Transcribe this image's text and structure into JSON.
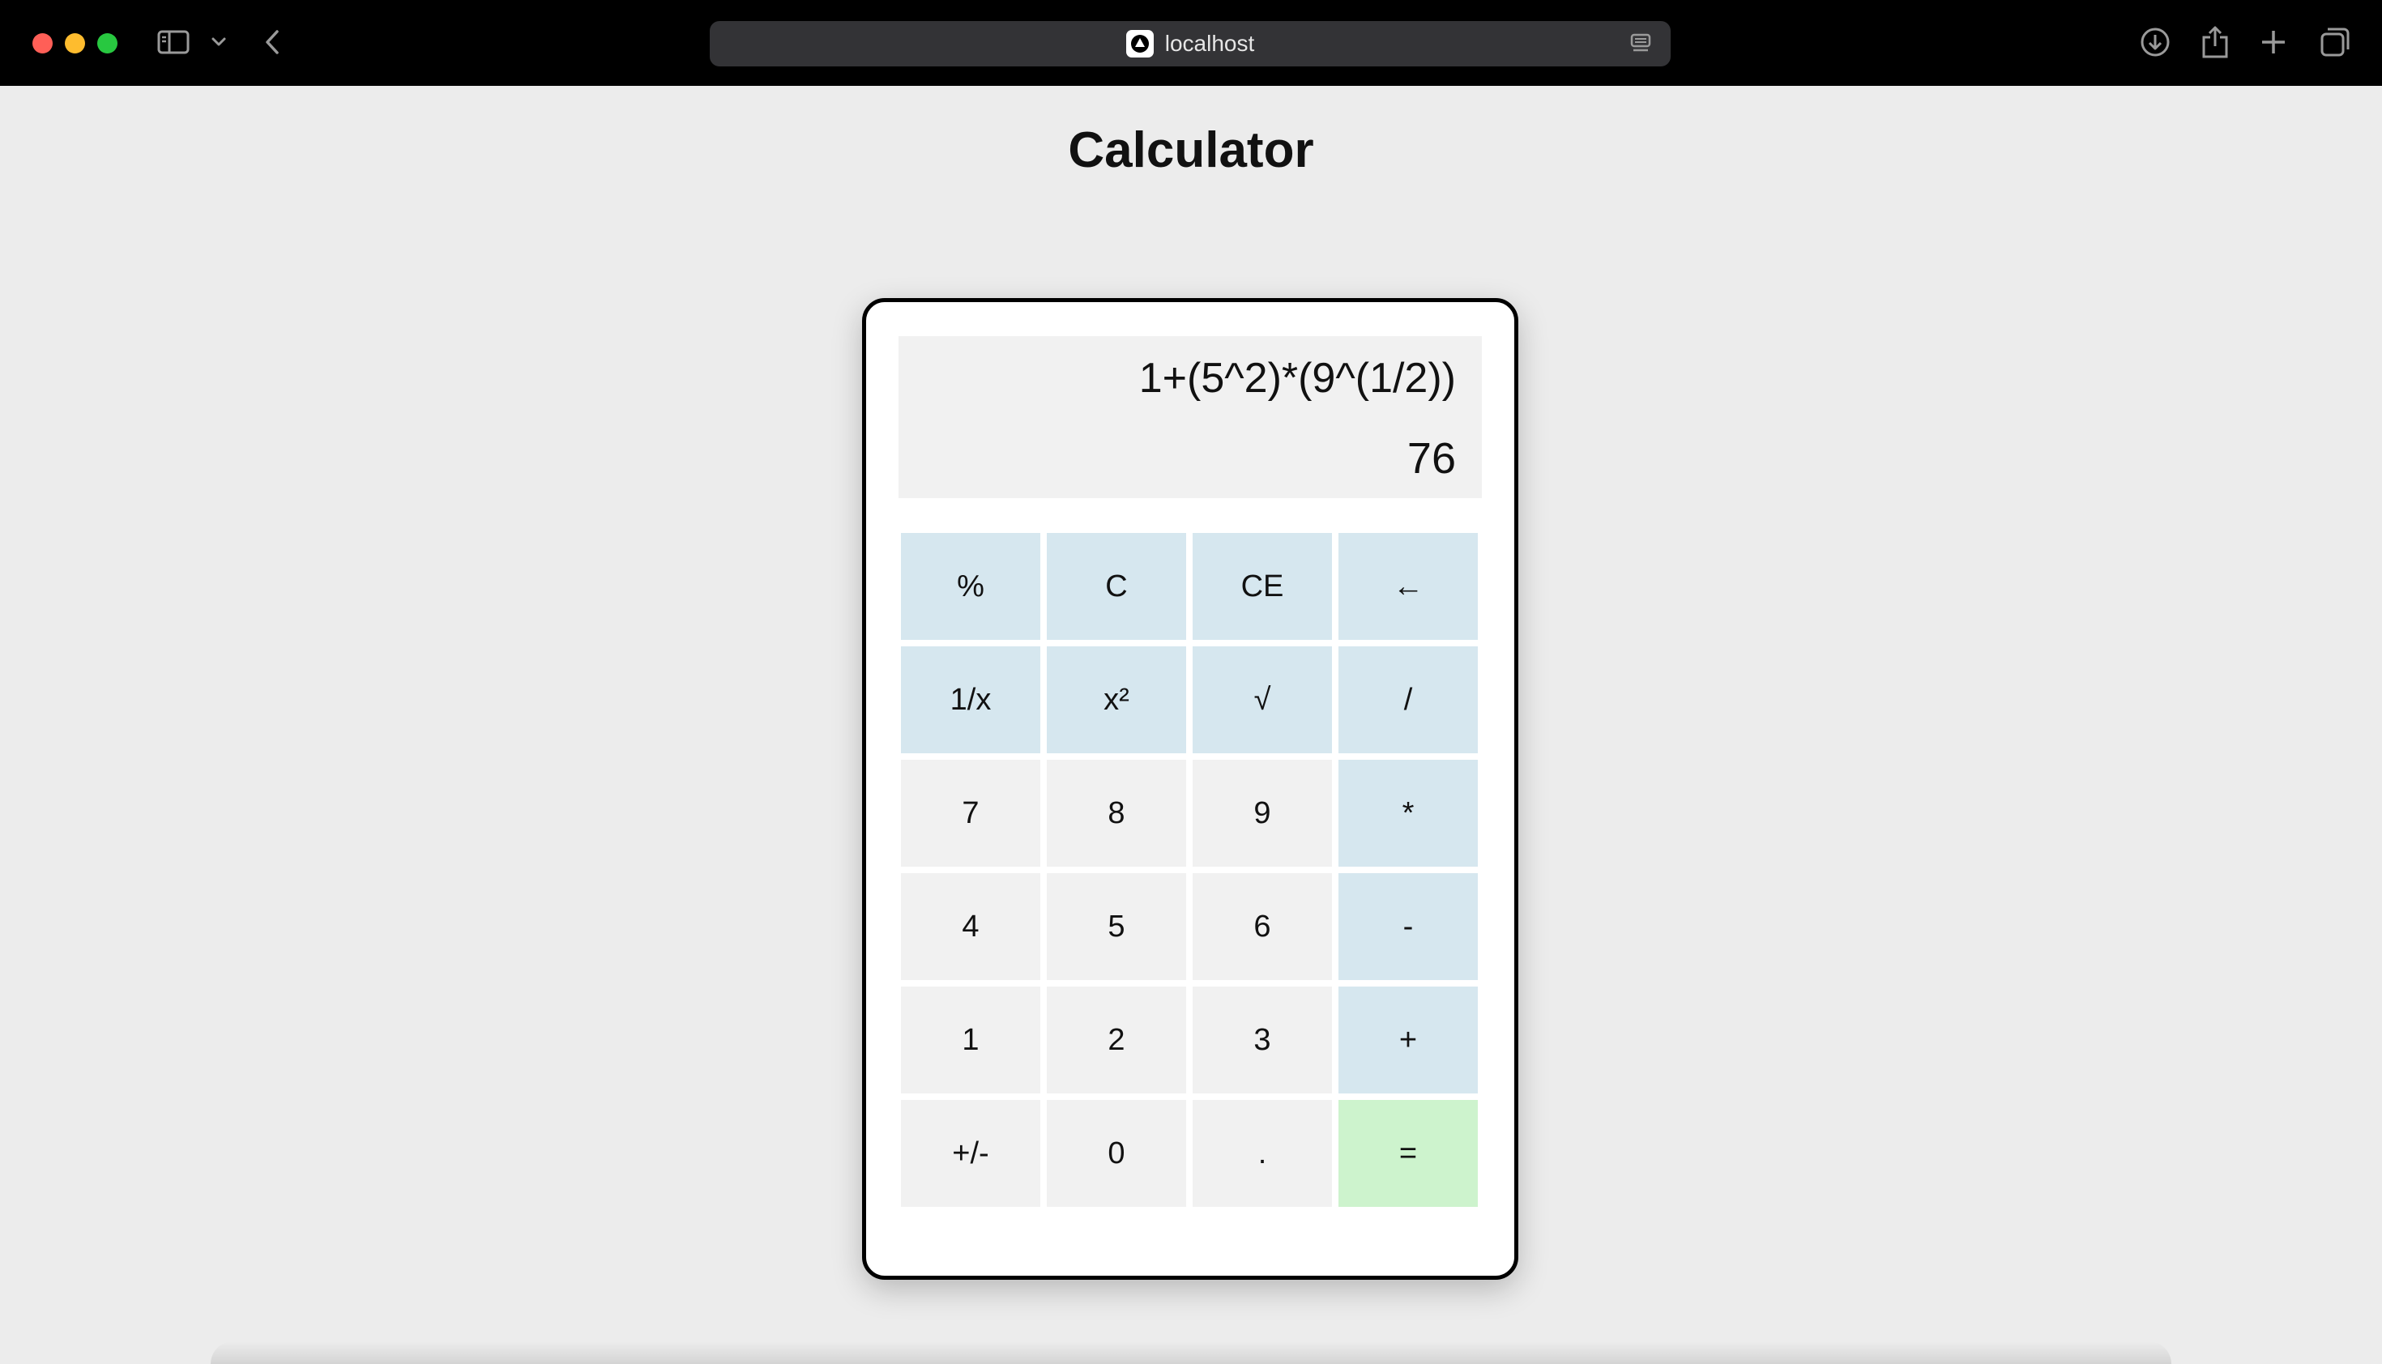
{
  "browser": {
    "url": "localhost"
  },
  "page": {
    "title": "Calculator"
  },
  "calculator": {
    "expression": "1+(5^2)*(9^(1/2))",
    "result": "76",
    "keys": [
      {
        "label": "%",
        "kind": "fn",
        "name": "percent-key"
      },
      {
        "label": "C",
        "kind": "fn",
        "name": "clear-key"
      },
      {
        "label": "CE",
        "kind": "fn",
        "name": "clear-entry-key"
      },
      {
        "label": "←",
        "kind": "fn",
        "name": "backspace-key"
      },
      {
        "label": "1/x",
        "kind": "fn",
        "name": "reciprocal-key"
      },
      {
        "label": "x²",
        "kind": "fn",
        "name": "square-key"
      },
      {
        "label": "√",
        "kind": "fn",
        "name": "sqrt-key"
      },
      {
        "label": "/",
        "kind": "fn",
        "name": "divide-key"
      },
      {
        "label": "7",
        "kind": "num",
        "name": "digit-7-key"
      },
      {
        "label": "8",
        "kind": "num",
        "name": "digit-8-key"
      },
      {
        "label": "9",
        "kind": "num",
        "name": "digit-9-key"
      },
      {
        "label": "*",
        "kind": "fn",
        "name": "multiply-key"
      },
      {
        "label": "4",
        "kind": "num",
        "name": "digit-4-key"
      },
      {
        "label": "5",
        "kind": "num",
        "name": "digit-5-key"
      },
      {
        "label": "6",
        "kind": "num",
        "name": "digit-6-key"
      },
      {
        "label": "-",
        "kind": "fn",
        "name": "subtract-key"
      },
      {
        "label": "1",
        "kind": "num",
        "name": "digit-1-key"
      },
      {
        "label": "2",
        "kind": "num",
        "name": "digit-2-key"
      },
      {
        "label": "3",
        "kind": "num",
        "name": "digit-3-key"
      },
      {
        "label": "+",
        "kind": "fn",
        "name": "add-key"
      },
      {
        "label": "+/-",
        "kind": "num",
        "name": "negate-key"
      },
      {
        "label": "0",
        "kind": "num",
        "name": "digit-0-key"
      },
      {
        "label": ".",
        "kind": "num",
        "name": "decimal-key"
      },
      {
        "label": "=",
        "kind": "eq",
        "name": "equals-key"
      }
    ]
  },
  "colors": {
    "function_key": "#d6e7ef",
    "number_key": "#f1f1f1",
    "equals_key": "#cdf3cd",
    "page_background": "#ececec"
  }
}
